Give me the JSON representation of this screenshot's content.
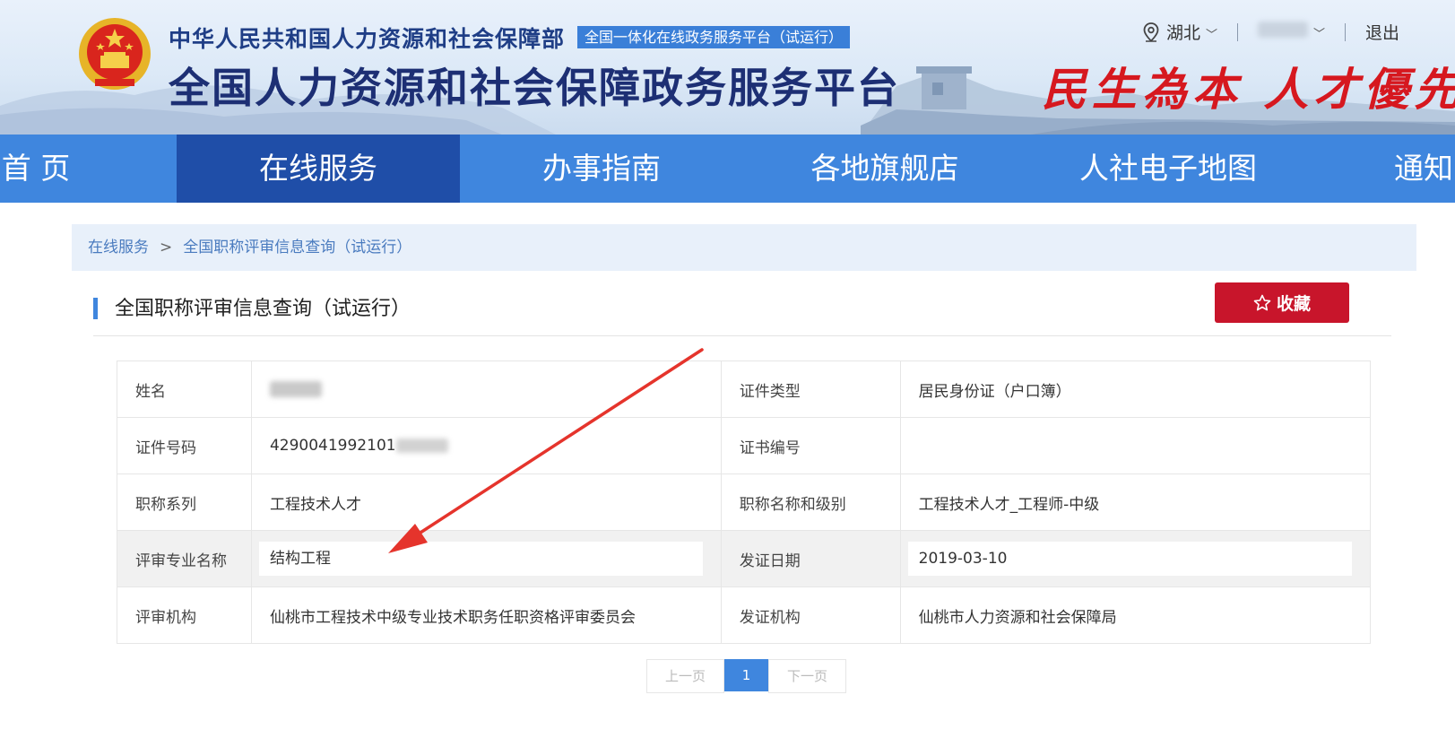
{
  "header": {
    "org_name": "中华人民共和国人力资源和社会保障部",
    "badge": "全国一体化在线政务服务平台（试运行）",
    "platform_name": "全国人力资源和社会保障政务服务平台",
    "slogan": "民生為本 人才優先",
    "location": "湖北",
    "logout": "退出"
  },
  "nav": {
    "items": [
      {
        "label": "首 页"
      },
      {
        "label": "在线服务",
        "active": true
      },
      {
        "label": "办事指南"
      },
      {
        "label": "各地旗舰店"
      },
      {
        "label": "人社电子地图"
      },
      {
        "label": "通知"
      }
    ]
  },
  "breadcrumb": {
    "root": "在线服务",
    "separator": ">",
    "current": "全国职称评审信息查询（试运行）"
  },
  "page": {
    "title": "全国职称评审信息查询（试运行）",
    "favorite_label": "收藏"
  },
  "info": {
    "rows": [
      {
        "l1": "姓名",
        "v1": "",
        "l2": "证件类型",
        "v2": "居民身份证（户口簿）"
      },
      {
        "l1": "证件号码",
        "v1": "4290041992101",
        "l2": "证书编号",
        "v2": ""
      },
      {
        "l1": "职称系列",
        "v1": "工程技术人才",
        "l2": "职称名称和级别",
        "v2": "工程技术人才_工程师-中级"
      },
      {
        "l1": "评审专业名称",
        "v1": "结构工程",
        "l2": "发证日期",
        "v2": "2019-03-10"
      },
      {
        "l1": "评审机构",
        "v1": "仙桃市工程技术中级专业技术职务任职资格评审委员会",
        "l2": "发证机构",
        "v2": "仙桃市人力资源和社会保障局"
      }
    ]
  },
  "pager": {
    "prev": "上一页",
    "current": "1",
    "next": "下一页"
  },
  "colors": {
    "nav_bg": "#3f86de",
    "nav_active": "#1f4ea8",
    "favorite_bg": "#c8152b",
    "slogan": "#d6181f",
    "arrow": "#e5342c"
  }
}
